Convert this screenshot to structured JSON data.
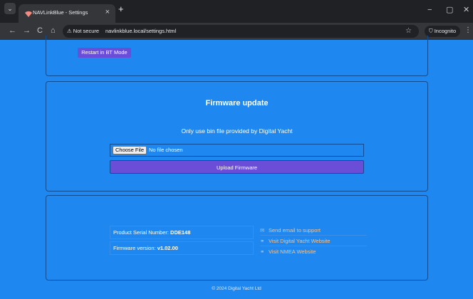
{
  "browser": {
    "tab_title": "NAVLinkBlue - Settings",
    "tab_close": "×",
    "new_tab": "+",
    "not_secure": "⚠ Not secure",
    "url": "navlinkblue.local/settings.html",
    "incognito": "Incognito",
    "controls": {
      "minimize": "−",
      "maximize": "▢",
      "close": "✕"
    },
    "nav": {
      "back": "←",
      "forward": "→",
      "reload": "C",
      "home": "⌂",
      "star": "☆",
      "menu": "⋮",
      "tab_list": "⌄"
    }
  },
  "top_panel": {
    "restart_label": "Restart in BT Mode"
  },
  "firmware": {
    "title": "Firmware update",
    "note": "Only use bin file provided by Digital Yacht",
    "choose_file": "Choose File",
    "no_file": "No file chosen",
    "upload_label": "Upload Firmware"
  },
  "info": {
    "serial_label": "Product Serial Number: ",
    "serial_value": "DDE148",
    "fw_label": "Firmware version: ",
    "fw_value": "v1.02.00",
    "links": {
      "email": "Send email to support",
      "dy": "Visit Digital Yacht Website",
      "nmea": "Visit NMEA Website"
    },
    "icons": {
      "email": "✉",
      "link": "⚭"
    }
  },
  "footer": "© 2024 Digital Yacht Ltd"
}
